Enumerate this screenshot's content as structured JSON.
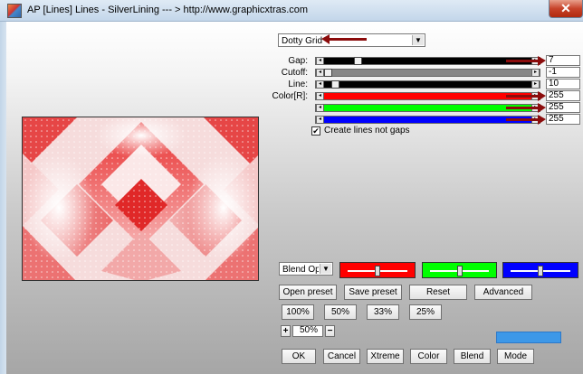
{
  "window": {
    "title": "AP [Lines]  Lines - SilverLining    --- > http://www.graphicxtras.com",
    "close_glyph": "✕"
  },
  "preset": {
    "selected": "Dotty Grid"
  },
  "params": [
    {
      "label": "Gap:",
      "value": "7",
      "fraction": 0.3
    },
    {
      "label": "Cutoff:",
      "value": "-1",
      "fraction": 0.0
    },
    {
      "label": "Line:",
      "value": "10",
      "fraction": 0.07
    }
  ],
  "color": {
    "label": "Color[R]:",
    "channels": [
      {
        "value": "255",
        "fill": "#ff0000"
      },
      {
        "value": "255",
        "fill": "#00ff00"
      },
      {
        "value": "255",
        "fill": "#0000ff"
      }
    ]
  },
  "create_lines": {
    "label": "Create lines not gaps",
    "checked": true,
    "mark": "✔"
  },
  "blend": {
    "selected": "Blend Opti",
    "sliders": [
      {
        "color": "#ff0000",
        "level": 0.5
      },
      {
        "color": "#00ff00",
        "level": 0.5
      },
      {
        "color": "#0000ff",
        "level": 0.5
      }
    ]
  },
  "buttons_row1": [
    "Open preset",
    "Save preset",
    "Reset",
    "Advanced"
  ],
  "zoom_buttons": [
    "100%",
    "50%",
    "33%",
    "25%"
  ],
  "zoom": {
    "plus": "+",
    "value": "50%",
    "minus": "−"
  },
  "bottom_buttons": [
    "OK",
    "Cancel",
    "Xtreme",
    "Color",
    "Blend",
    "Mode"
  ]
}
